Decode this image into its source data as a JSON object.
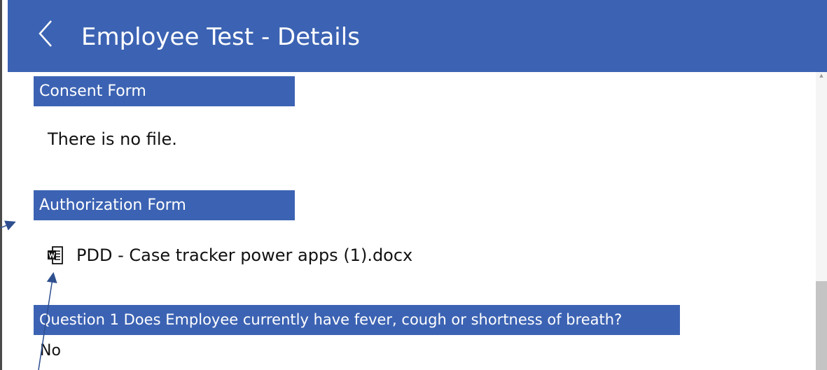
{
  "header": {
    "title": "Employee Test - Details",
    "back_icon": "chevron-left-icon",
    "background": "#3c63b3"
  },
  "sections": {
    "consent": {
      "label": "Consent Form",
      "value": "There is no file."
    },
    "authorization": {
      "label": "Authorization Form",
      "file_icon": "word-document-icon",
      "file_name": "PDD - Case tracker power apps (1).docx"
    },
    "question1": {
      "label": "Question 1 Does Employee currently have fever, cough or shortness of breath?",
      "answer": "No"
    }
  },
  "scrollbar": {
    "up_icon": "scroll-up-arrow-icon"
  },
  "colors": {
    "accent": "#3c63b3",
    "annotation_arrow": "#2e4f8f"
  }
}
